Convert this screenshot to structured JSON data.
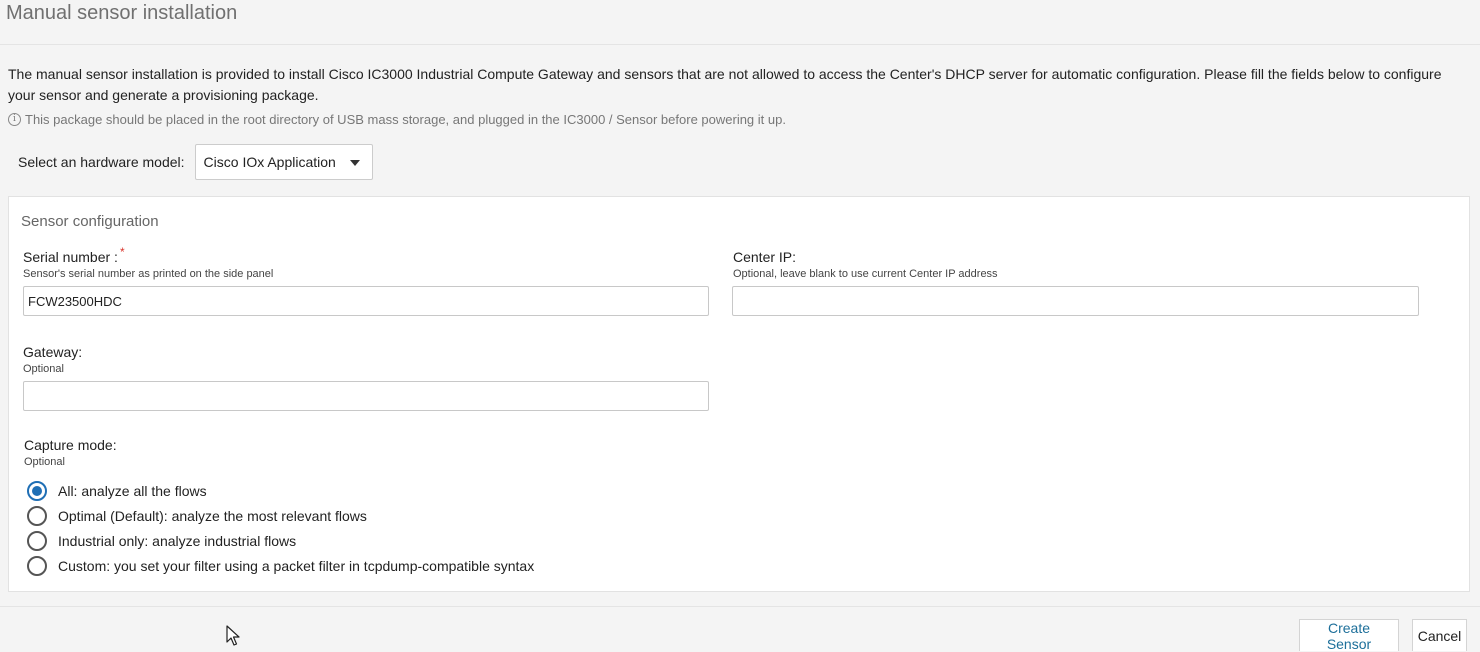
{
  "page": {
    "title": "Manual sensor installation",
    "description": "The manual sensor installation is provided to install Cisco IC3000 Industrial Compute Gateway and sensors that are not allowed to access the Center's DHCP server for automatic configuration. Please fill the fields below to configure your sensor and generate a provisioning package.",
    "note_icon": "info-icon",
    "note": "This package should be placed in the root directory of USB mass storage, and plugged in the IC3000 / Sensor before powering it up."
  },
  "hardware_model": {
    "label": "Select an hardware model:",
    "selected": "Cisco IOx Application"
  },
  "sensor_config": {
    "title": "Sensor configuration",
    "serial_number": {
      "label": "Serial number :",
      "required_mark": "*",
      "hint": "Sensor's serial number as printed on the side panel",
      "value": "FCW23500HDC"
    },
    "center_ip": {
      "label": "Center IP:",
      "hint": "Optional, leave blank to use current Center IP address",
      "value": ""
    },
    "gateway": {
      "label": "Gateway:",
      "hint": "Optional",
      "value": ""
    },
    "capture_mode": {
      "label": "Capture mode:",
      "hint": "Optional",
      "options": [
        {
          "label": "All: analyze all the flows",
          "checked": true
        },
        {
          "label": "Optimal (Default): analyze the most relevant flows",
          "checked": false
        },
        {
          "label": "Industrial only: analyze industrial flows",
          "checked": false
        },
        {
          "label": "Custom: you set your filter using a packet filter in tcpdump-compatible syntax",
          "checked": false
        }
      ]
    }
  },
  "footer": {
    "create_label": "Create Sensor",
    "cancel_label": "Cancel"
  },
  "colors": {
    "accent": "#1f6fb5",
    "link": "#1d6f9a",
    "required": "#d9342b"
  }
}
